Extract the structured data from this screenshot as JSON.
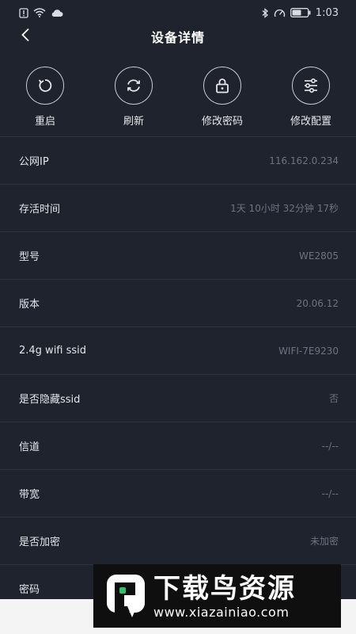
{
  "status_bar": {
    "time": "1:03",
    "icons": [
      "sim-alert-icon",
      "wifi-icon",
      "cloud-icon",
      "bluetooth-icon",
      "speed-icon",
      "battery-icon"
    ]
  },
  "header": {
    "title": "设备详情",
    "back_icon": "chevron-left-icon"
  },
  "actions": [
    {
      "label": "重启",
      "icon": "restart-icon"
    },
    {
      "label": "刷新",
      "icon": "refresh-icon"
    },
    {
      "label": "修改密码",
      "icon": "lock-icon"
    },
    {
      "label": "修改配置",
      "icon": "sliders-icon"
    }
  ],
  "details": [
    {
      "label": "公网IP",
      "value": "116.162.0.234"
    },
    {
      "label": "存活时间",
      "value": "1天 10小时 32分钟 17秒"
    },
    {
      "label": "型号",
      "value": "WE2805"
    },
    {
      "label": "版本",
      "value": "20.06.12"
    },
    {
      "label": "2.4g wifi ssid",
      "value": "WIFI-7E9230"
    },
    {
      "label": "是否隐藏ssid",
      "value": "否"
    },
    {
      "label": "信道",
      "value": "--/--"
    },
    {
      "label": "带宽",
      "value": "--/--"
    },
    {
      "label": "是否加密",
      "value": "未加密"
    },
    {
      "label": "密码",
      "value": ""
    }
  ],
  "watermark": {
    "title": "下载鸟资源",
    "url": "www.xiazainiao.com"
  },
  "colors": {
    "background": "#1f232d",
    "divider": "#2f3440",
    "value_text": "#6c7381",
    "watermark_bg": "#0f0f10",
    "watermark_green": "#2ec36b"
  }
}
